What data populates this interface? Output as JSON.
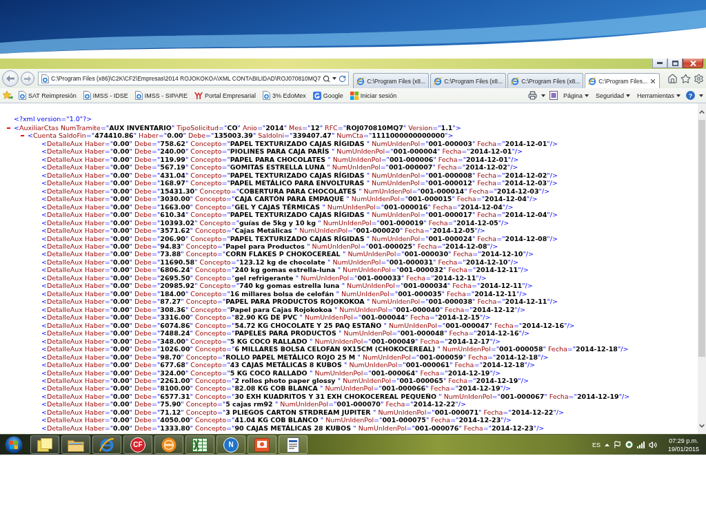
{
  "browser": {
    "address": "C:\\Program Files (x86)\\C2K\\CF2\\Empresas\\2014 ROJOKOKOA\\XML CONTABILIDAD\\ROJ070810MQ7",
    "tabs": [
      {
        "label": "C:\\Program Files (x8...",
        "selected": false
      },
      {
        "label": "C:\\Program Files (x8...",
        "selected": false
      },
      {
        "label": "C:\\Program Files (x8...",
        "selected": false
      },
      {
        "label": "C:\\Program Files...",
        "selected": true
      }
    ],
    "favorites": [
      {
        "label": "SAT Reimpresión",
        "kind": "page"
      },
      {
        "label": "IMSS - IDSE",
        "kind": "page"
      },
      {
        "label": "IMSS - SIPARE",
        "kind": "page"
      },
      {
        "label": "Portal Empresarial",
        "kind": "emblem"
      },
      {
        "label": "3% EdoMex",
        "kind": "page"
      },
      {
        "label": "Google",
        "kind": "tile"
      },
      {
        "label": "Iniciar sesión",
        "kind": "squares"
      }
    ],
    "menus": [
      "Página",
      "Seguridad",
      "Herramientas"
    ],
    "help": "?"
  },
  "document": {
    "declaration": "<?xml version=\"1.0\"?>",
    "root": {
      "text": "<AuxiliarCtas NumTramite=\"AUX INVENTARIO\" TipoSolicitud=\"CO\" Anio=\"2014\" Mes=\"12\" RFC=\"ROJ070810MQ7\" Version=\"1.1\">",
      "expanded": true,
      "children": [
        {
          "text": "<Cuenta SaldoFin=\"474410.86\" Haber=\"0.00\" Debe=\"135003.39\" SaldoIni=\"339407.47\" NumCta=\"1111000000000000\">",
          "expanded": true,
          "children": [
            {
              "text": "<DetalleAux Haber=\"0.00\" Debe=\"758.62\" Concepto=\"PAPEL TEXTURIZADO CAJAS RÍGIDAS \" NumUnIdenPol=\"001-000003\" Fecha=\"2014-12-01\"/>"
            },
            {
              "text": "<DetalleAux Haber=\"0.00\" Debe=\"240.00\" Concepto=\"PIOLINES PARA CAJA PARÍS \" NumUnIdenPol=\"001-000004\" Fecha=\"2014-12-01\"/>"
            },
            {
              "text": "<DetalleAux Haber=\"0.00\" Debe=\"119.99\" Concepto=\"PAPEL PARA CHOCOLATES \" NumUnIdenPol=\"001-000006\" Fecha=\"2014-12-01\"/>"
            },
            {
              "text": "<DetalleAux Haber=\"0.00\" Debe=\"567.19\" Concepto=\"GOMITAS ESTRELLA LUNA \" NumUnIdenPol=\"001-000007\" Fecha=\"2014-12-02\"/>"
            },
            {
              "text": "<DetalleAux Haber=\"0.00\" Debe=\"431.04\" Concepto=\"PAPEL TEXTURIZADO CAJAS RÍGIDAS \" NumUnIdenPol=\"001-000008\" Fecha=\"2014-12-02\"/>"
            },
            {
              "text": "<DetalleAux Haber=\"0.00\" Debe=\"168.97\" Concepto=\"PAPEL METÁLICO PARA ENVOLTURAS \" NumUnIdenPol=\"001-000012\" Fecha=\"2014-12-03\"/>"
            },
            {
              "text": "<DetalleAux Haber=\"0.00\" Debe=\"15431.30\" Concepto=\"COBERTURA PARA CHOCOLATES \" NumUnIdenPol=\"001-000014\" Fecha=\"2014-12-03\"/>"
            },
            {
              "text": "<DetalleAux Haber=\"0.00\" Debe=\"3030.00\" Concepto=\"CAJA CARTÓN PARA EMPAQUE \" NumUnIdenPol=\"001-000015\" Fecha=\"2014-12-04\"/>"
            },
            {
              "text": "<DetalleAux Haber=\"0.00\" Debe=\"1663.00\" Concepto=\"GEL Y CAJAS TÉRMICAS \" NumUnIdenPol=\"001-000016\" Fecha=\"2014-12-04\"/>"
            },
            {
              "text": "<DetalleAux Haber=\"0.00\" Debe=\"610.34\" Concepto=\"PAPEL TEXTURIZADO CAJAS RÍGIDAS \" NumUnIdenPol=\"001-000017\" Fecha=\"2014-12-04\"/>"
            },
            {
              "text": "<DetalleAux Haber=\"0.00\" Debe=\"10393.02\" Concepto=\"guías de 5kg y 10 kg \" NumUnIdenPol=\"001-000019\" Fecha=\"2014-12-05\"/>"
            },
            {
              "text": "<DetalleAux Haber=\"0.00\" Debe=\"3571.62\" Concepto=\"Cajas Metálicas \" NumUnIdenPol=\"001-000020\" Fecha=\"2014-12-05\"/>"
            },
            {
              "text": "<DetalleAux Haber=\"0.00\" Debe=\"206.90\" Concepto=\"PAPEL TEXTURIZADO CAJAS RÍGIDAS \" NumUnIdenPol=\"001-000024\" Fecha=\"2014-12-08\"/>"
            },
            {
              "text": "<DetalleAux Haber=\"0.00\" Debe=\"94.83\" Concepto=\"Papel para Productos \" NumUnIdenPol=\"001-000025\" Fecha=\"2014-12-08\"/>"
            },
            {
              "text": "<DetalleAux Haber=\"0.00\" Debe=\"73.88\" Concepto=\"CORN FLAKES P CHOKOCEREAL \" NumUnIdenPol=\"001-000030\" Fecha=\"2014-12-10\"/>"
            },
            {
              "text": "<DetalleAux Haber=\"0.00\" Debe=\"11690.58\" Concepto=\"123.12 kg de chocolate \" NumUnIdenPol=\"001-000031\" Fecha=\"2014-12-10\"/>"
            },
            {
              "text": "<DetalleAux Haber=\"0.00\" Debe=\"6806.24\" Concepto=\"240 kg gomas estrella-luna \" NumUnIdenPol=\"001-000032\" Fecha=\"2014-12-11\"/>"
            },
            {
              "text": "<DetalleAux Haber=\"0.00\" Debe=\"2695.50\" Concepto=\"gel refrigerante \" NumUnIdenPol=\"001-000033\" Fecha=\"2014-12-11\"/>"
            },
            {
              "text": "<DetalleAux Haber=\"0.00\" Debe=\"20985.92\" Concepto=\"740 kg gomas estrella luna \" NumUnIdenPol=\"001-000034\" Fecha=\"2014-12-11\"/>"
            },
            {
              "text": "<DetalleAux Haber=\"0.00\" Debe=\"184.00\" Concepto=\"16 millares bolsa de celofán \" NumUnIdenPol=\"001-000035\" Fecha=\"2014-12-11\"/>"
            },
            {
              "text": "<DetalleAux Haber=\"0.00\" Debe=\"87.27\" Concepto=\"PAPEL PARA PRODUCTOS ROJOKOKOA \" NumUnIdenPol=\"001-000038\" Fecha=\"2014-12-11\"/>"
            },
            {
              "text": "<DetalleAux Haber=\"0.00\" Debe=\"308.36\" Concepto=\"Papel para Cajas Rojokokoa \" NumUnIdenPol=\"001-000040\" Fecha=\"2014-12-12\"/>"
            },
            {
              "text": "<DetalleAux Haber=\"0.00\" Debe=\"3316.00\" Concepto=\"82.90 KG DE PVC \" NumUnIdenPol=\"001-000044\" Fecha=\"2014-12-15\"/>"
            },
            {
              "text": "<DetalleAux Haber=\"0.00\" Debe=\"6074.86\" Concepto=\"54.72 KG CHOCOLATE Y 25 PAQ ESTAÑO \" NumUnIdenPol=\"001-000047\" Fecha=\"2014-12-16\"/>"
            },
            {
              "text": "<DetalleAux Haber=\"0.00\" Debe=\"7488.24\" Concepto=\"PAPELES PARA PRODUCTOS \" NumUnIdenPol=\"001-000048\" Fecha=\"2014-12-16\"/>"
            },
            {
              "text": "<DetalleAux Haber=\"0.00\" Debe=\"348.00\" Concepto=\"5 KG COCO RALLADO \" NumUnIdenPol=\"001-000049\" Fecha=\"2014-12-17\"/>"
            },
            {
              "text": "<DetalleAux Haber=\"0.00\" Debe=\"1026.00\" Concepto=\"6 MILLARES BOLSA CELOFAN 9X15CM (CHOKOCEREAL) \" NumUnIdenPol=\"001-000058\" Fecha=\"2014-12-18\"/>"
            },
            {
              "text": "<DetalleAux Haber=\"0.00\" Debe=\"98.70\" Concepto=\"ROLLO PAPEL METÁLICO ROJO 25 M \" NumUnIdenPol=\"001-000059\" Fecha=\"2014-12-18\"/>"
            },
            {
              "text": "<DetalleAux Haber=\"0.00\" Debe=\"677.68\" Concepto=\"43 CAJAS METÁLICAS 8 KUBOS \" NumUnIdenPol=\"001-000061\" Fecha=\"2014-12-18\"/>"
            },
            {
              "text": "<DetalleAux Haber=\"0.00\" Debe=\"324.00\" Concepto=\"5 KG COCO RALLADO \" NumUnIdenPol=\"001-000064\" Fecha=\"2014-12-19\"/>"
            },
            {
              "text": "<DetalleAux Haber=\"0.00\" Debe=\"2261.00\" Concepto=\"2 rollos photo paper glossy \" NumUnIdenPol=\"001-000065\" Fecha=\"2014-12-19\"/>"
            },
            {
              "text": "<DetalleAux Haber=\"0.00\" Debe=\"8100.00\" Concepto=\"82.08 KG COB BLANCA \" NumUnIdenPol=\"001-000066\" Fecha=\"2014-12-19\"/>"
            },
            {
              "text": "<DetalleAux Haber=\"0.00\" Debe=\"6577.31\" Concepto=\"30 EXH KUADRITOS Y 31 EXH CHOKOCEREAL PEQUEÑO \" NumUnIdenPol=\"001-000067\" Fecha=\"2014-12-19\"/>"
            },
            {
              "text": "<DetalleAux Haber=\"0.00\" Debe=\"75.90\" Concepto=\"5 cajas rm92 \" NumUnIdenPol=\"001-000070\" Fecha=\"2014-12-22\"/>"
            },
            {
              "text": "<DetalleAux Haber=\"0.00\" Debe=\"71.12\" Concepto=\"3 PLIEGOS CARTON STRDREAM JUPITER \" NumUnIdenPol=\"001-000071\" Fecha=\"2014-12-22\"/>"
            },
            {
              "text": "<DetalleAux Haber=\"0.00\" Debe=\"4050.00\" Concepto=\"41.04 KG COB BLANCO \" NumUnIdenPol=\"001-000075\" Fecha=\"2014-12-23\"/>"
            },
            {
              "text": "<DetalleAux Haber=\"0.00\" Debe=\"1333.80\" Concepto=\"90 CAJAS METÁLICAS 28 KUBOS \" NumUnIdenPol=\"001-000076\" Fecha=\"2014-12-23\"/>"
            }
          ]
        }
      ]
    }
  },
  "taskbar": {
    "apps": [
      {
        "kind": "notes"
      },
      {
        "kind": "folder"
      },
      {
        "kind": "browser"
      },
      {
        "kind": "badge",
        "label": "CF",
        "color": "#d3222c"
      },
      {
        "kind": "disc"
      },
      {
        "kind": "sheet"
      },
      {
        "kind": "badge",
        "label": "N",
        "color": "#1f74cc"
      },
      {
        "kind": "slides"
      },
      {
        "kind": "document"
      }
    ],
    "language": "ES",
    "time": "07:29 p.m.",
    "date": "19/01/2015"
  }
}
